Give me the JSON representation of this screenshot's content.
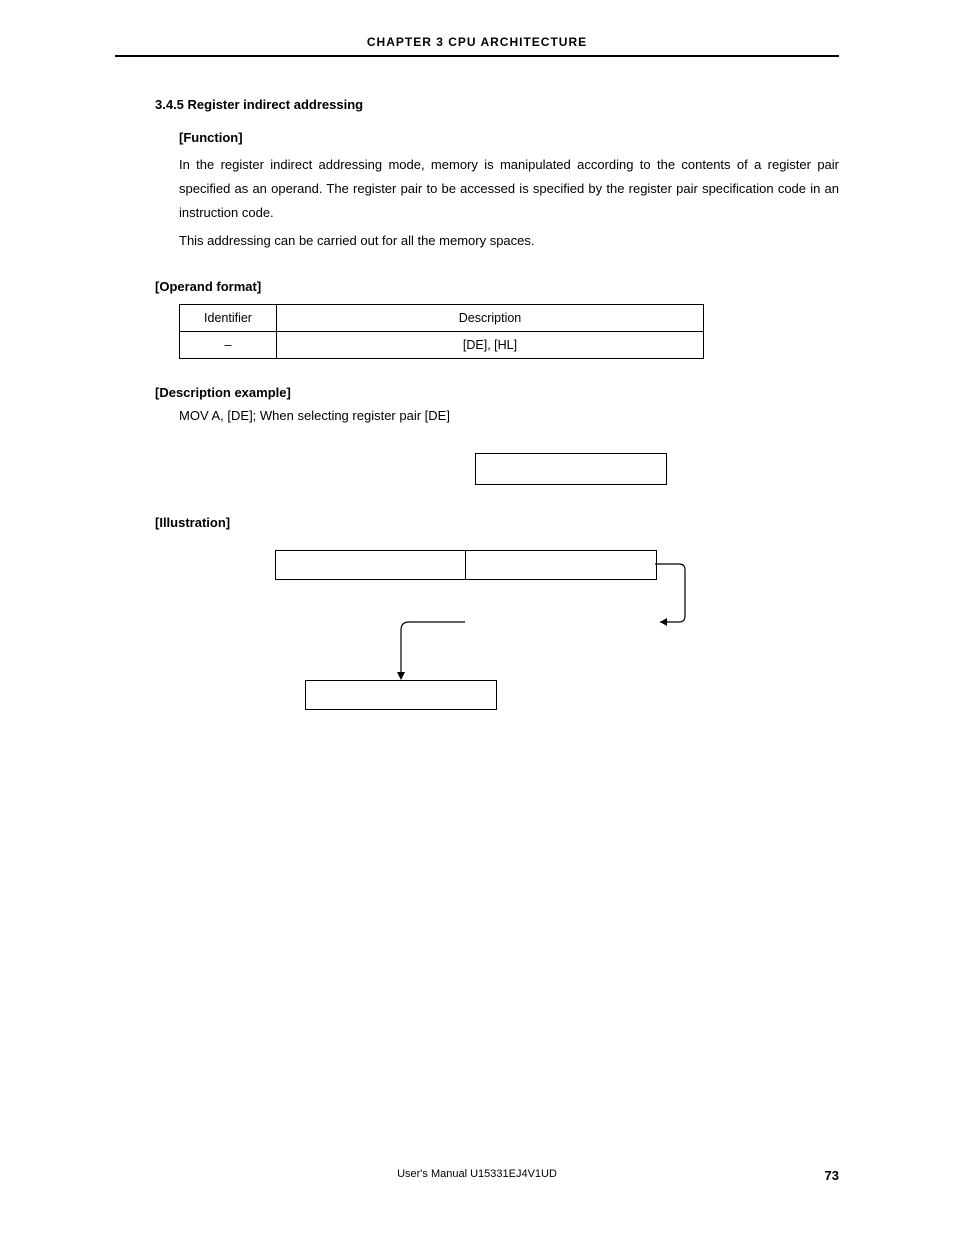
{
  "header": {
    "chapter": "CHAPTER  3   CPU  ARCHITECTURE"
  },
  "section": {
    "number_title": "3.4.5  Register indirect addressing"
  },
  "function": {
    "heading": "[Function]",
    "para1": "In the register indirect addressing mode, memory is manipulated according to the contents of a register pair specified as an operand.  The register pair to be accessed is specified by the register pair specification code in an instruction code.",
    "para2": "This addressing can be carried out for all the memory spaces."
  },
  "operand": {
    "heading": "[Operand format]",
    "col1": "Identifier",
    "col2": "Description",
    "row1_id": "–",
    "row1_desc": "[DE], [HL]"
  },
  "desc_example": {
    "heading": "[Description example]",
    "text": "MOV A, [DE]; When selecting register pair [DE]"
  },
  "illustration": {
    "heading": "[Illustration]"
  },
  "footer": {
    "manual": "User's Manual  U15331EJ4V1UD",
    "page": "73"
  }
}
